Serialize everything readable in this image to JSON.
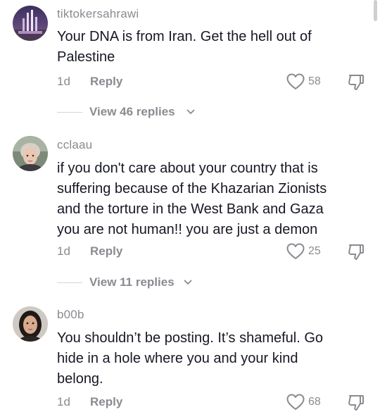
{
  "comments": [
    {
      "username": "tiktokersahrawi",
      "text": "Your DNA is from Iran. Get the hell out of\nPalestine",
      "time": "1d",
      "reply_label": "Reply",
      "likes": "58",
      "view_replies": "View 46 replies"
    },
    {
      "username": "cclaau",
      "text": "if you don't care about your country that is\nsuffering because of the Khazarian Zionists\nand the torture in the West Bank and Gaza\nyou are not human!! you are just a demon",
      "time": "1d",
      "reply_label": "Reply",
      "likes": "25",
      "view_replies": "View 11 replies"
    },
    {
      "username": "b00b",
      "text": "You shouldn’t be posting. It’s shameful. Go\nhide in a hole where you and your kind\nbelong.",
      "time": "1d",
      "reply_label": "Reply",
      "likes": "68"
    }
  ],
  "icons": {
    "like": "heart-outline-icon",
    "dislike": "thumbs-down-icon",
    "chevron": "chevron-down-icon"
  },
  "colors": {
    "text": "#161823",
    "secondary": "#8a8b91",
    "divider": "#d6d6d8"
  }
}
